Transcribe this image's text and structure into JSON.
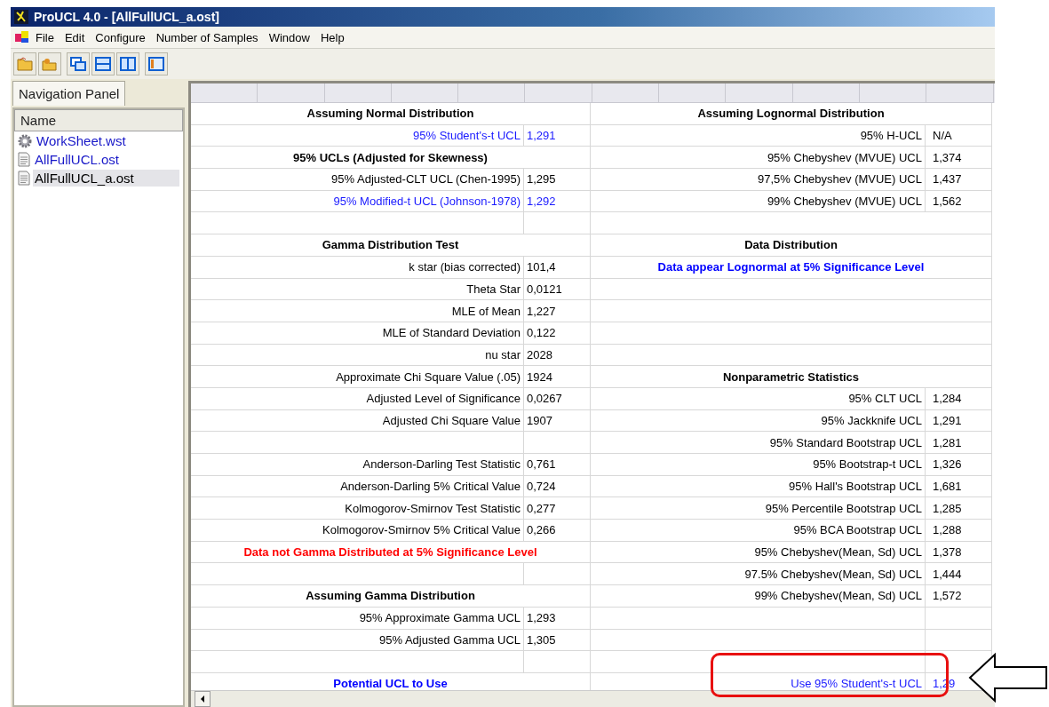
{
  "window": {
    "title": "ProUCL 4.0 - [AllFullUCL_a.ost]"
  },
  "menu": [
    "File",
    "Edit",
    "Configure",
    "Number of Samples",
    "Window",
    "Help"
  ],
  "toolbar": [
    {
      "kind": "open"
    },
    {
      "kind": "folders"
    },
    {
      "kind": "cascade"
    },
    {
      "kind": "tile-horizontal"
    },
    {
      "kind": "tile-vertical"
    },
    {
      "kind": "panel"
    }
  ],
  "navigation": {
    "tab": "Navigation Panel",
    "header": "Name",
    "items": [
      {
        "label": "WorkSheet.wst",
        "kind": "worksheet",
        "selected": false
      },
      {
        "label": "AllFullUCL.ost",
        "kind": "output",
        "selected": false
      },
      {
        "label": "AllFullUCL_a.ost",
        "kind": "output",
        "selected": true
      }
    ]
  },
  "sheet": {
    "rows": [
      {
        "left": {
          "kind": "heading",
          "label": "Assuming Normal Distribution"
        },
        "right": {
          "kind": "heading",
          "label": "Assuming Lognormal Distribution"
        }
      },
      {
        "left": {
          "kind": "highlight",
          "label": "95% Student's-t UCL",
          "value": "1,291"
        },
        "right": {
          "kind": "plain",
          "label": "95% H-UCL",
          "value": "N/A"
        }
      },
      {
        "left": {
          "kind": "heading",
          "label": "95% UCLs (Adjusted for Skewness)"
        },
        "right": {
          "kind": "plain",
          "label": "95% Chebyshev (MVUE) UCL",
          "value": "1,374"
        }
      },
      {
        "left": {
          "kind": "plain",
          "label": "95% Adjusted-CLT  UCL (Chen-1995)",
          "value": "1,295"
        },
        "right": {
          "kind": "plain",
          "label": "97,5% Chebyshev (MVUE) UCL",
          "value": "1,437"
        }
      },
      {
        "left": {
          "kind": "highlight",
          "label": "95% Modified-t UCL (Johnson-1978)",
          "value": "1,292"
        },
        "right": {
          "kind": "plain",
          "label": "99% Chebyshev (MVUE) UCL",
          "value": "1,562"
        }
      },
      {
        "left": {
          "kind": "plain"
        },
        "right": {
          "kind": "span"
        }
      },
      {
        "left": {
          "kind": "heading",
          "label": "Gamma Distribution Test"
        },
        "right": {
          "kind": "heading",
          "label": "Data Distribution"
        }
      },
      {
        "left": {
          "kind": "plain",
          "label": "k star (bias corrected)",
          "value": "101,4"
        },
        "right": {
          "kind": "conclusion",
          "label": "Data appear Lognormal at 5% Significance Level"
        }
      },
      {
        "left": {
          "kind": "plain",
          "label": "Theta Star",
          "value": "0,0121"
        },
        "right": {
          "kind": "span"
        }
      },
      {
        "left": {
          "kind": "plain",
          "label": "MLE of Mean",
          "value": "1,227"
        },
        "right": {
          "kind": "span"
        }
      },
      {
        "left": {
          "kind": "plain",
          "label": "MLE of Standard Deviation",
          "value": "0,122"
        },
        "right": {
          "kind": "span"
        }
      },
      {
        "left": {
          "kind": "plain",
          "label": "nu star",
          "value": "2028"
        },
        "right": {
          "kind": "span"
        }
      },
      {
        "left": {
          "kind": "plain",
          "label": "Approximate Chi Square Value (.05)",
          "value": "1924"
        },
        "right": {
          "kind": "heading",
          "label": "Nonparametric Statistics"
        }
      },
      {
        "left": {
          "kind": "plain",
          "label": "Adjusted Level of Significance",
          "value": "0,0267"
        },
        "right": {
          "kind": "plain",
          "label": "95% CLT UCL",
          "value": "1,284"
        }
      },
      {
        "left": {
          "kind": "plain",
          "label": "Adjusted Chi Square Value",
          "value": "1907"
        },
        "right": {
          "kind": "plain",
          "label": "95% Jackknife UCL",
          "value": "1,291"
        }
      },
      {
        "left": {
          "kind": "plain"
        },
        "right": {
          "kind": "plain",
          "label": "95% Standard Bootstrap UCL",
          "value": "1,281"
        }
      },
      {
        "left": {
          "kind": "plain",
          "label": "Anderson-Darling Test Statistic",
          "value": "0,761"
        },
        "right": {
          "kind": "plain",
          "label": "95% Bootstrap-t UCL",
          "value": "1,326"
        }
      },
      {
        "left": {
          "kind": "plain",
          "label": "Anderson-Darling 5% Critical Value",
          "value": "0,724"
        },
        "right": {
          "kind": "plain",
          "label": "95% Hall's Bootstrap UCL",
          "value": "1,681"
        }
      },
      {
        "left": {
          "kind": "plain",
          "label": "Kolmogorov-Smirnov Test Statistic",
          "value": "0,277"
        },
        "right": {
          "kind": "plain",
          "label": "95% Percentile Bootstrap UCL",
          "value": "1,285"
        }
      },
      {
        "left": {
          "kind": "plain",
          "label": "Kolmogorov-Smirnov 5% Critical Value",
          "value": "0,266"
        },
        "right": {
          "kind": "plain",
          "label": "95% BCA Bootstrap UCL",
          "value": "1,288"
        }
      },
      {
        "left": {
          "kind": "alert",
          "label": "Data not Gamma Distributed at 5% Significance Level"
        },
        "right": {
          "kind": "plain",
          "label": "95% Chebyshev(Mean, Sd) UCL",
          "value": "1,378"
        }
      },
      {
        "left": {
          "kind": "plain"
        },
        "right": {
          "kind": "plain",
          "label": "97.5% Chebyshev(Mean, Sd) UCL",
          "value": "1,444"
        }
      },
      {
        "left": {
          "kind": "heading",
          "label": "Assuming Gamma Distribution"
        },
        "right": {
          "kind": "plain",
          "label": "99% Chebyshev(Mean, Sd) UCL",
          "value": "1,572"
        }
      },
      {
        "left": {
          "kind": "plain",
          "label": "95% Approximate Gamma UCL",
          "value": "1,293"
        },
        "right": {
          "kind": "plain"
        }
      },
      {
        "left": {
          "kind": "plain",
          "label": "95% Adjusted Gamma UCL",
          "value": "1,305"
        },
        "right": {
          "kind": "plain"
        }
      },
      {
        "left": {
          "kind": "plain"
        },
        "right": {
          "kind": "plain"
        }
      },
      {
        "left": {
          "kind": "conclusion",
          "label": "Potential UCL to Use"
        },
        "right": {
          "kind": "highlight",
          "label": "Use 95% Student's-t UCL",
          "value": "1,29",
          "marked": true
        }
      }
    ]
  }
}
